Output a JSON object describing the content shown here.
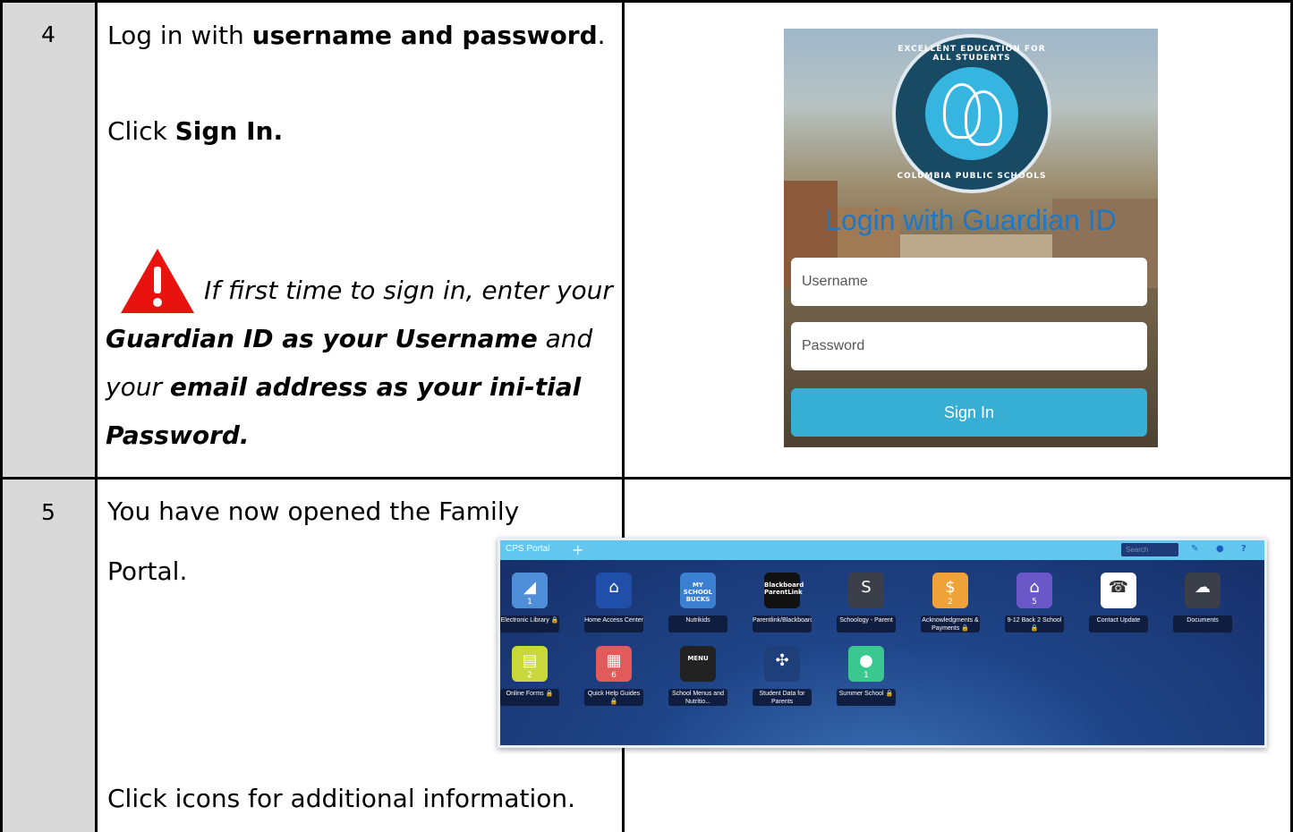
{
  "rows": [
    {
      "step": "4",
      "line1_pre": "Log in with ",
      "line1_bold": "username and password",
      "line1_post": ".",
      "line2_pre": "Click ",
      "line2_bold": "Sign In.",
      "warning_1": "If first time to sign in, enter your ",
      "warning_2": "Guardian ID as your Username",
      "warning_3": " and your ",
      "warning_4": "email address as your ini-tial Password."
    },
    {
      "step": "5",
      "line1": "You have now opened the Family",
      "line2": "Portal.",
      "line3": "Click icons for additional information."
    }
  ],
  "login_screenshot": {
    "seal_top": "EXCELLENT EDUCATION FOR ALL STUDENTS",
    "seal_bottom": "COLUMBIA PUBLIC SCHOOLS",
    "title": "Login with Guardian ID",
    "username_placeholder": "Username",
    "password_placeholder": "Password",
    "signin_label": "Sign In"
  },
  "portal_screenshot": {
    "title": "CPS Portal",
    "plus": "+",
    "search_placeholder": "Search",
    "edit_icon": "✎",
    "bell_icon": "●",
    "help_icon": "?",
    "tiles": [
      {
        "label": "Electronic Library 🔒",
        "badge": "1",
        "color": "#4f8fd8",
        "icon": "◢"
      },
      {
        "label": "Home Access Center",
        "badge": "",
        "color": "#1f4fa8",
        "icon": "⌂"
      },
      {
        "label": "Nutrikids",
        "badge": "",
        "color": "#3b7fd0",
        "icon": "MY SCHOOL BUCKS"
      },
      {
        "label": "Parentlink/Blackboard",
        "badge": "",
        "color": "#111111",
        "icon": "Blackboard ParentLink"
      },
      {
        "label": "Schoology - Parent",
        "badge": "",
        "color": "#3a3f4a",
        "icon": "S"
      },
      {
        "label": "Acknowledgments & Payments 🔒",
        "badge": "2",
        "color": "#f0a23a",
        "icon": "$"
      },
      {
        "label": "9-12 Back 2 School 🔒",
        "badge": "5",
        "color": "#6a58c8",
        "icon": "⌂"
      },
      {
        "label": "Contact Update",
        "badge": "",
        "color": "#ffffff",
        "icon": "☎"
      },
      {
        "label": "Documents",
        "badge": "",
        "color": "#3a3f4a",
        "icon": "☁"
      },
      {
        "label": "Online Forms 🔒",
        "badge": "2",
        "color": "#c8d83a",
        "icon": "▤"
      },
      {
        "label": "Quick Help Guides 🔒",
        "badge": "6",
        "color": "#e25a5a",
        "icon": "▦"
      },
      {
        "label": "School Menus and Nutritio...",
        "badge": "",
        "color": "#222222",
        "icon": "MENU"
      },
      {
        "label": "Student Data for Parents",
        "badge": "",
        "color": "#1f3f7a",
        "icon": "✣"
      },
      {
        "label": "Summer School 🔒",
        "badge": "1",
        "color": "#3ac890",
        "icon": "●"
      }
    ]
  }
}
